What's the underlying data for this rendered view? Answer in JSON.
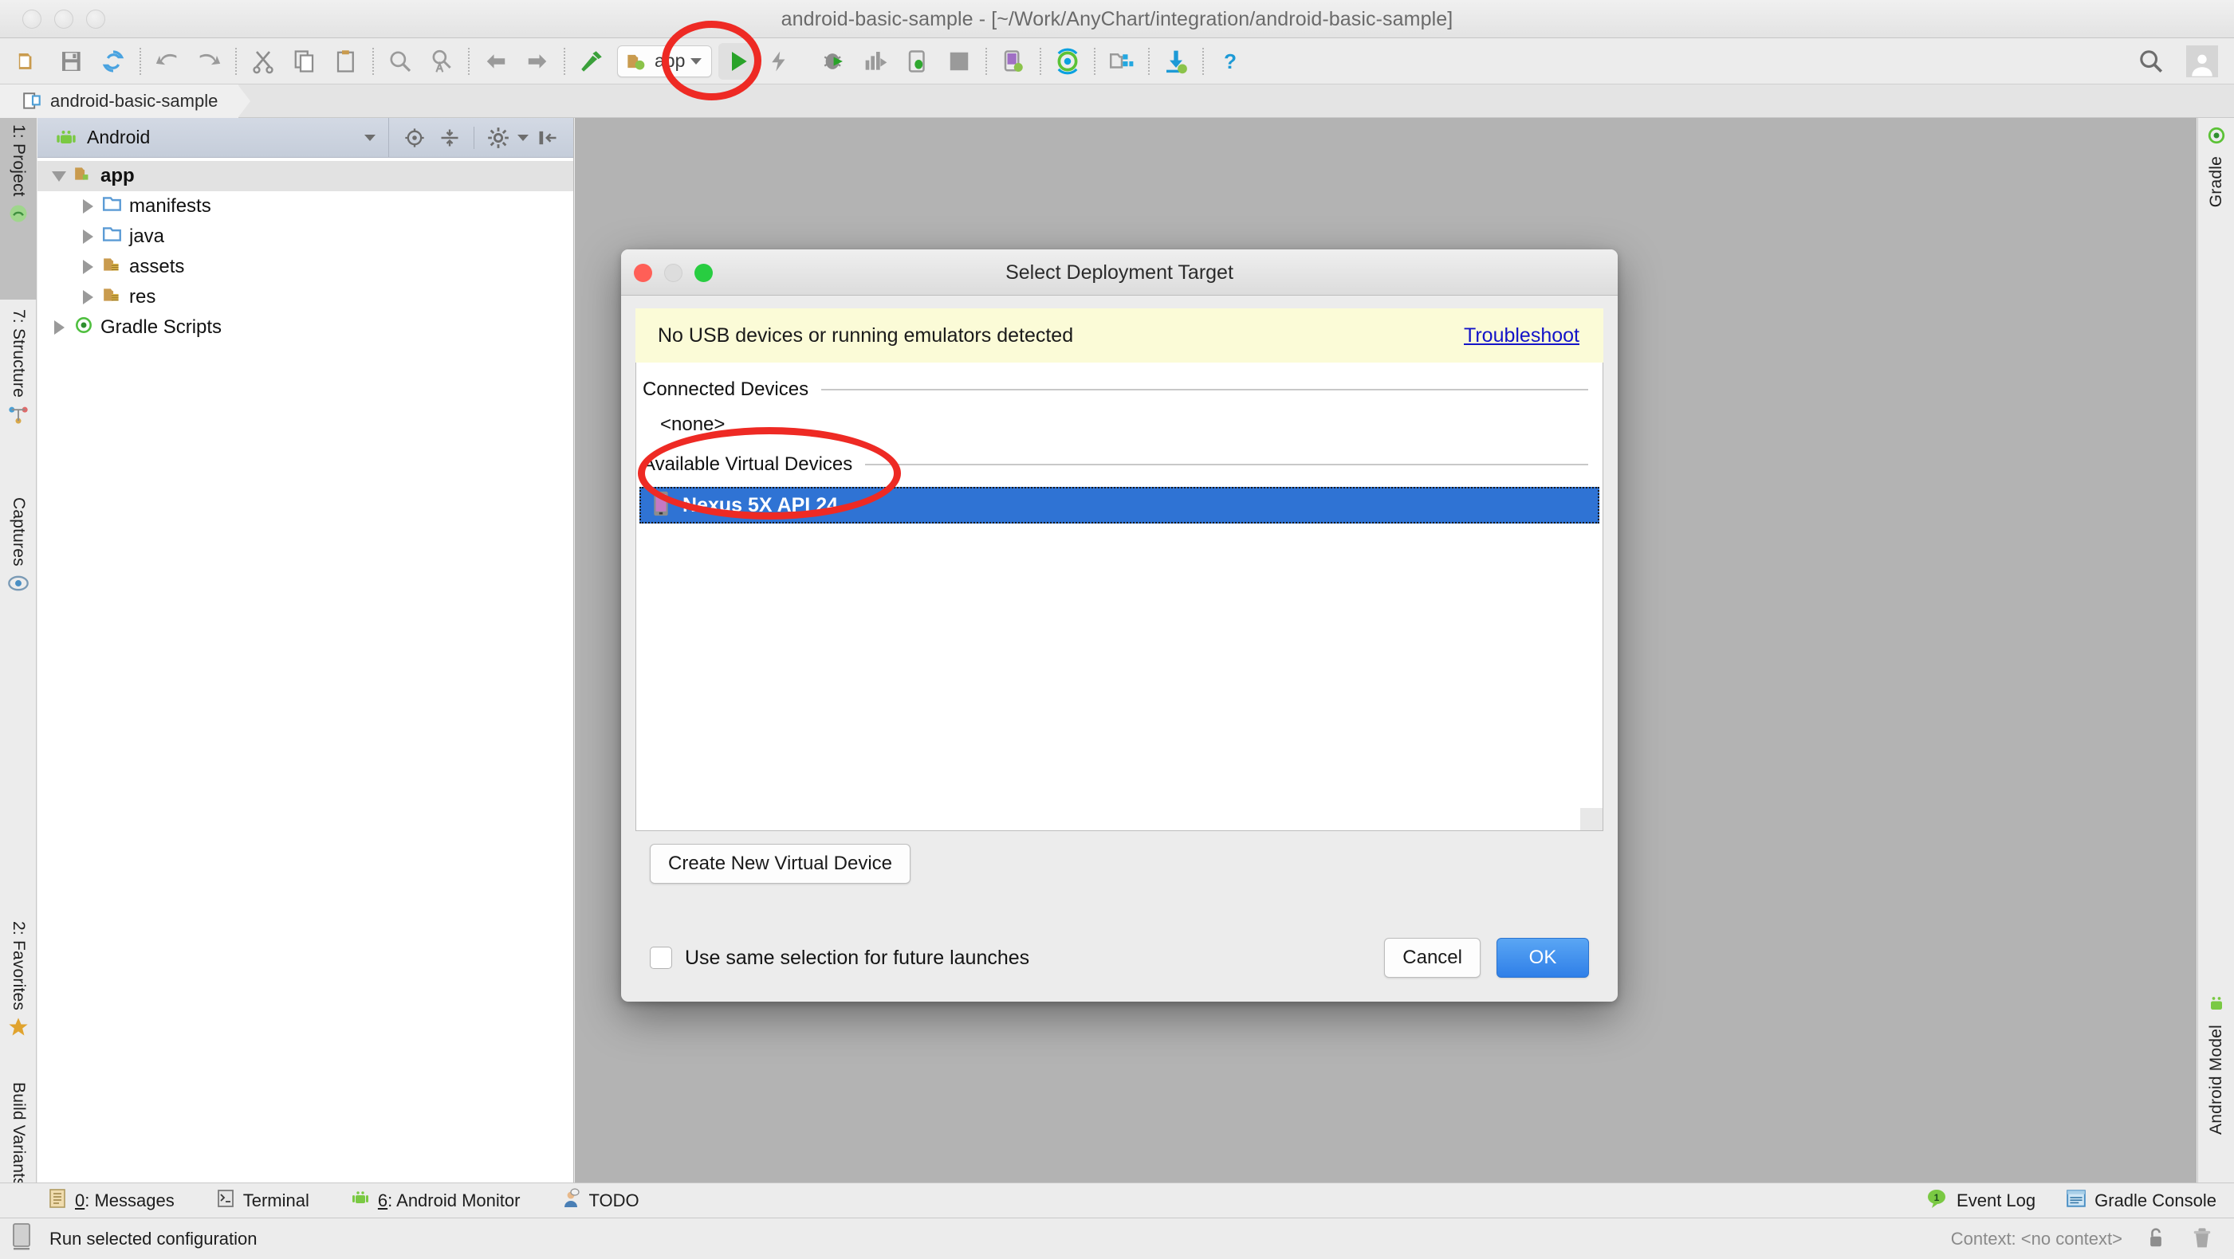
{
  "window": {
    "title": "android-basic-sample - [~/Work/AnyChart/integration/android-basic-sample]"
  },
  "toolbar": {
    "icons": [
      {
        "name": "open-folder-icon",
        "glyph": "folder"
      },
      {
        "name": "save-all-icon",
        "glyph": "save"
      },
      {
        "name": "sync-icon",
        "glyph": "sync"
      },
      {
        "name": "undo-icon",
        "glyph": "undo"
      },
      {
        "name": "redo-icon",
        "glyph": "redo"
      },
      {
        "name": "cut-icon",
        "glyph": "cut"
      },
      {
        "name": "copy-icon",
        "glyph": "copy"
      },
      {
        "name": "paste-icon",
        "glyph": "paste"
      },
      {
        "name": "find-icon",
        "glyph": "find"
      },
      {
        "name": "replace-icon",
        "glyph": "replace"
      },
      {
        "name": "back-icon",
        "glyph": "back"
      },
      {
        "name": "forward-icon",
        "glyph": "forward"
      },
      {
        "name": "build-hammer-icon",
        "glyph": "hammer"
      }
    ],
    "run_config_label": "app",
    "run_button": "run-icon",
    "right_icons": [
      {
        "name": "apply-changes-icon"
      },
      {
        "name": "debug-icon"
      },
      {
        "name": "run-with-coverage-icon"
      },
      {
        "name": "attach-debugger-icon"
      },
      {
        "name": "stop-icon"
      },
      {
        "name": "avd-manager-icon"
      },
      {
        "name": "sync-gradle-icon"
      },
      {
        "name": "project-structure-icon"
      },
      {
        "name": "sdk-manager-icon"
      },
      {
        "name": "help-icon"
      }
    ],
    "search_icon": "search-icon",
    "avatar_icon": "avatar-icon"
  },
  "breadcrumb": {
    "project_name": "android-basic-sample"
  },
  "left_strip": {
    "tabs": [
      {
        "label": "1: Project",
        "icon": "project-icon",
        "selected": true
      },
      {
        "label": "7: Structure",
        "icon": "structure-icon",
        "selected": false
      },
      {
        "label": "Captures",
        "icon": "captures-icon",
        "selected": false
      },
      {
        "label": "2: Favorites",
        "icon": "favorites-star-icon",
        "selected": false
      },
      {
        "label": "Build Variants",
        "icon": "build-variants-icon",
        "selected": false
      }
    ]
  },
  "right_strip": {
    "tabs": [
      {
        "label": "Gradle",
        "icon": "gradle-icon"
      },
      {
        "label": "Android Model",
        "icon": "android-model-icon"
      }
    ]
  },
  "project_panel": {
    "view_name": "Android",
    "view_icon": "android-robot-icon",
    "tools": [
      {
        "name": "scroll-from-source-icon"
      },
      {
        "name": "collapse-all-icon"
      },
      {
        "name": "settings-gear-icon"
      },
      {
        "name": "hide-panel-icon"
      }
    ],
    "tree": [
      {
        "label": "app",
        "icon": "module-folder-icon",
        "expanded": true,
        "depth": 0,
        "bold": true,
        "selected": true
      },
      {
        "label": "manifests",
        "icon": "blue-folder-icon",
        "expanded": false,
        "depth": 1,
        "bold": false,
        "selected": false
      },
      {
        "label": "java",
        "icon": "blue-folder-icon",
        "expanded": false,
        "depth": 1,
        "bold": false,
        "selected": false
      },
      {
        "label": "assets",
        "icon": "resource-folder-icon",
        "expanded": false,
        "depth": 1,
        "bold": false,
        "selected": false
      },
      {
        "label": "res",
        "icon": "resource-folder-icon",
        "expanded": false,
        "depth": 1,
        "bold": false,
        "selected": false
      },
      {
        "label": "Gradle Scripts",
        "icon": "gradle-icon",
        "expanded": false,
        "depth": 0,
        "bold": false,
        "selected": false
      }
    ]
  },
  "dialog": {
    "title": "Select Deployment Target",
    "warning_message": "No USB devices or running emulators detected",
    "troubleshoot_link": "Troubleshoot",
    "connected_devices_label": "Connected Devices",
    "connected_devices_none": "<none>",
    "available_devices_label": "Available Virtual Devices",
    "available_devices": [
      {
        "name": "Nexus 5X API 24",
        "icon": "virtual-device-icon",
        "selected": true
      }
    ],
    "create_device_label": "Create New Virtual Device",
    "remember_checkbox_label": "Use same selection for future launches",
    "remember_checked": false,
    "cancel_label": "Cancel",
    "ok_label": "OK"
  },
  "bottom_bar": {
    "tabs": [
      {
        "label_prefix": "0",
        "label": ": Messages",
        "icon": "messages-icon"
      },
      {
        "label_prefix": "",
        "label": "Terminal",
        "icon": "terminal-icon"
      },
      {
        "label_prefix": "6",
        "label": ": Android Monitor",
        "icon": "android-monitor-icon"
      },
      {
        "label_prefix": "",
        "label": "TODO",
        "icon": "todo-icon"
      }
    ],
    "event_log_label": "Event Log",
    "event_log_count": "1",
    "gradle_console_label": "Gradle Console"
  },
  "status_bar": {
    "message": "Run selected configuration",
    "context": "Context: <no context>",
    "lock_icon": "unlocked-icon",
    "trash_icon": "trash-icon"
  },
  "colors": {
    "accent_blue": "#2f73d4",
    "ok_button": "#2f7fe8",
    "warning_bg": "#fbfbd7",
    "link": "#1313c8",
    "annotation_red": "#ee2a24",
    "android_green": "#3ddc84"
  }
}
